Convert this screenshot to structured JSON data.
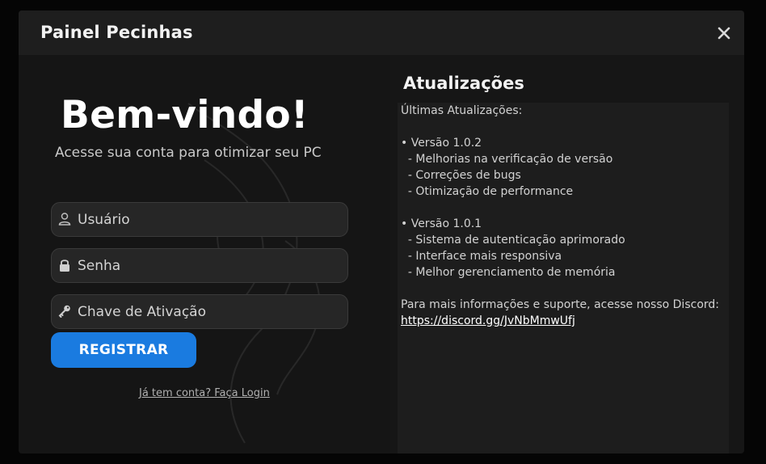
{
  "window": {
    "title": "Painel Pecinhas",
    "close_icon": "close-icon"
  },
  "left": {
    "welcome": "Bem-vindo!",
    "subtitle": "Acesse sua conta para otimizar seu PC",
    "fields": [
      {
        "placeholder": "Usuário",
        "value": "",
        "icon": "user-icon"
      },
      {
        "placeholder": "Senha",
        "value": "",
        "icon": "lock-icon"
      },
      {
        "placeholder": "Chave de Ativação",
        "value": "",
        "icon": "key-icon"
      }
    ],
    "register_label": "REGISTRAR",
    "login_link": "Já tem conta? Faça Login"
  },
  "right": {
    "title": "Atualizações",
    "lines": [
      "Últimas Atualizações:",
      "",
      "• Versão 1.0.2",
      "  - Melhorias na verificação de versão",
      "  - Correções de bugs",
      "  - Otimização de performance",
      "",
      "• Versão 1.0.1",
      "  - Sistema de autenticação aprimorado",
      "  - Interface mais responsiva",
      "  - Melhor gerenciamento de memória",
      "",
      "Para mais informações e suporte, acesse nosso Discord:"
    ],
    "discord_link": "https://discord.gg/JvNbMmwUfj"
  },
  "colors": {
    "accent": "#1a7be0",
    "window_bg": "#161616",
    "titlebar_bg": "#1e1e1e",
    "field_bg": "#262626"
  }
}
